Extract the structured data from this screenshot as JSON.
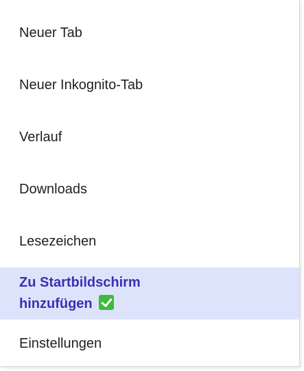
{
  "menu": {
    "items": [
      {
        "label": "Neuer Tab"
      },
      {
        "label": "Neuer Inkognito-Tab"
      },
      {
        "label": "Verlauf"
      },
      {
        "label": "Downloads"
      },
      {
        "label": "Lesezeichen"
      },
      {
        "label_line1": "Zu Startbildschirm",
        "label_line2": "hinzufügen",
        "icon": "check-mark-icon",
        "highlighted": true
      },
      {
        "label": "Einstellungen"
      }
    ]
  },
  "colors": {
    "highlight_bg": "#dde3fb",
    "highlight_text": "#3b2fb3",
    "text": "#1f1f1f",
    "check_green": "#3dbb3d"
  }
}
